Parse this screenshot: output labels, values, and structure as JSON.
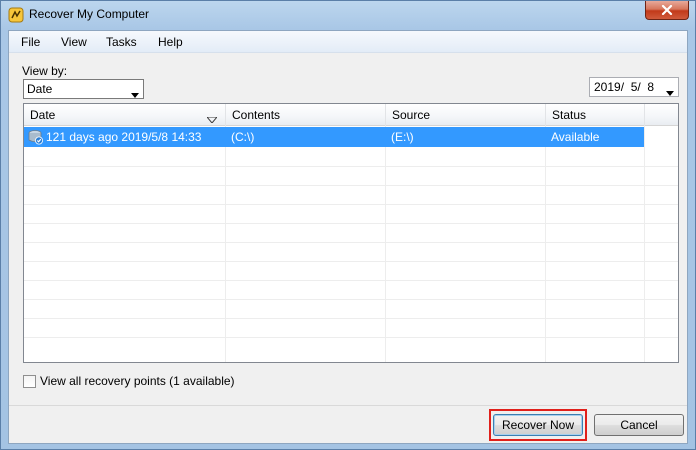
{
  "window": {
    "title": "Recover My Computer"
  },
  "menu": {
    "items": [
      "File",
      "View",
      "Tasks",
      "Help"
    ]
  },
  "view_by": {
    "label": "View by:",
    "selected": "Date"
  },
  "date_picker": {
    "value": "2019/  5/  8"
  },
  "table": {
    "columns": [
      "Date",
      "Contents",
      "Source",
      "Status"
    ],
    "rows": [
      {
        "date": "121 days ago 2019/5/8 14:33",
        "contents": "(C:\\)",
        "source": "(E:\\)",
        "status": "Available",
        "selected": true
      }
    ]
  },
  "options": {
    "view_all_label": "View all recovery points (1 available)",
    "view_all_checked": false
  },
  "buttons": {
    "recover_now": "Recover Now",
    "cancel": "Cancel"
  },
  "colors": {
    "selection": "#3399ff",
    "highlight": "#e0201b"
  },
  "icons": {
    "title": "app-logo-icon",
    "row": "recovery-point-icon",
    "close": "close-icon"
  }
}
